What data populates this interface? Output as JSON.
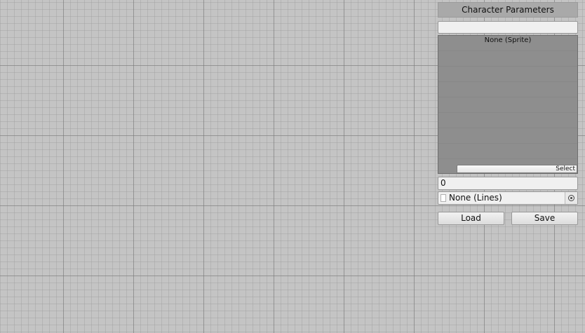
{
  "panel": {
    "title": "Character Parameters",
    "name_field": {
      "value": "",
      "placeholder": ""
    },
    "sprite": {
      "label": "None (Sprite)",
      "select_label": "Select"
    },
    "number_field": {
      "value": "0"
    },
    "lines_field": {
      "label": "None (Lines)",
      "icon": "object-picker-icon"
    },
    "buttons": {
      "load": "Load",
      "save": "Save"
    }
  },
  "colors": {
    "grid_background": "#c4c4c4",
    "panel_title_bg": "#a9a9a9",
    "sprite_preview_bg": "#8e8e8e"
  }
}
